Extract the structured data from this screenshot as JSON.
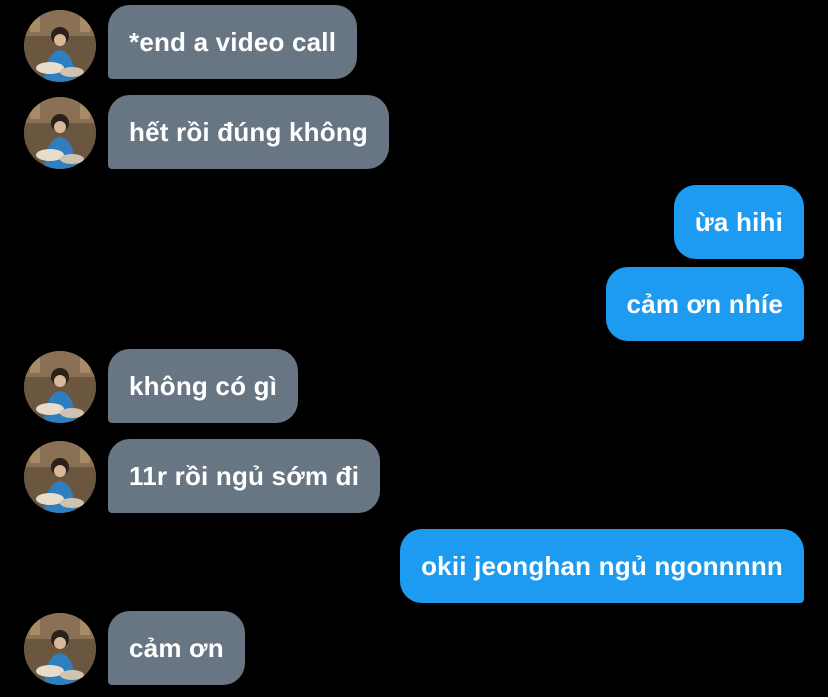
{
  "conversation": {
    "messages": [
      {
        "sender": "them",
        "text": "*end a video call"
      },
      {
        "sender": "them",
        "text": "hết rồi đúng không"
      },
      {
        "sender": "me",
        "text": "ừa hihi"
      },
      {
        "sender": "me",
        "text": "cảm ơn nhíe"
      },
      {
        "sender": "them",
        "text": "không có gì"
      },
      {
        "sender": "them",
        "text": "11r rồi ngủ sớm đi"
      },
      {
        "sender": "me",
        "text": "okii jeonghan ngủ ngonnnnn"
      },
      {
        "sender": "them",
        "text": "cảm ơn"
      }
    ]
  },
  "colors": {
    "background": "#000000",
    "incoming_bubble": "#687684",
    "outgoing_bubble": "#1d9bf0",
    "text": "#ffffff"
  },
  "icons": {
    "avatar": "contact-avatar-photo"
  }
}
